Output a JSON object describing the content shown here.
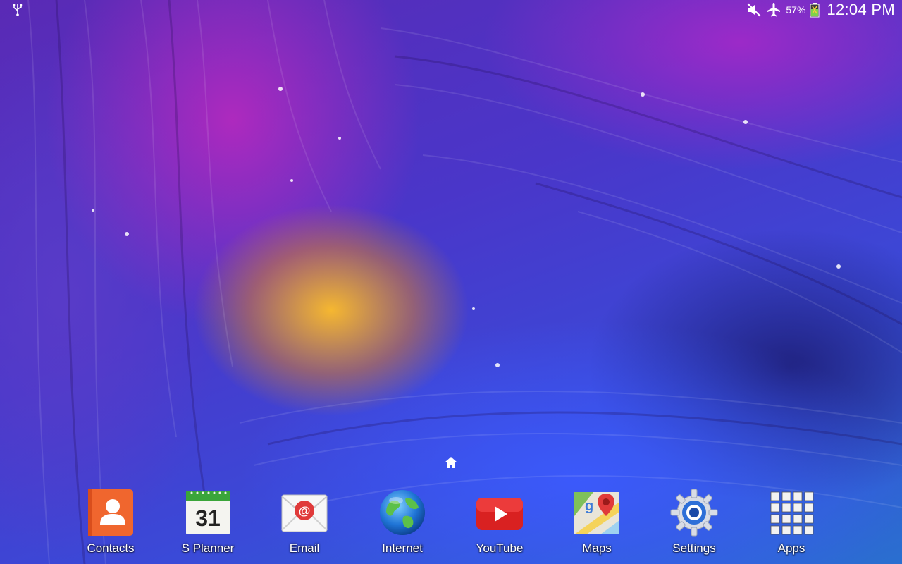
{
  "status_bar": {
    "battery_percent": "57%",
    "time": "12:04 PM",
    "left_icons": [
      "usb-icon"
    ],
    "right_icons": [
      "mute-icon",
      "airplane-mode-icon",
      "battery-icon"
    ]
  },
  "home": {
    "page_indicator_icon": "home-icon"
  },
  "dock": {
    "apps": [
      {
        "label": "Contacts",
        "icon": "contacts-icon",
        "color": "#f0662e"
      },
      {
        "label": "S Planner",
        "icon": "calendar-icon",
        "day": "31",
        "color": "#3aa53a"
      },
      {
        "label": "Email",
        "icon": "email-icon",
        "color": "#e03a3a"
      },
      {
        "label": "Internet",
        "icon": "globe-icon",
        "color": "#2a7fd6"
      },
      {
        "label": "YouTube",
        "icon": "youtube-icon",
        "color": "#d92121"
      },
      {
        "label": "Maps",
        "icon": "maps-icon",
        "color": "#4caf50"
      },
      {
        "label": "Settings",
        "icon": "gear-icon",
        "color": "#2d6fd8"
      },
      {
        "label": "Apps",
        "icon": "apps-grid-icon",
        "color": "#ffffff"
      }
    ]
  }
}
